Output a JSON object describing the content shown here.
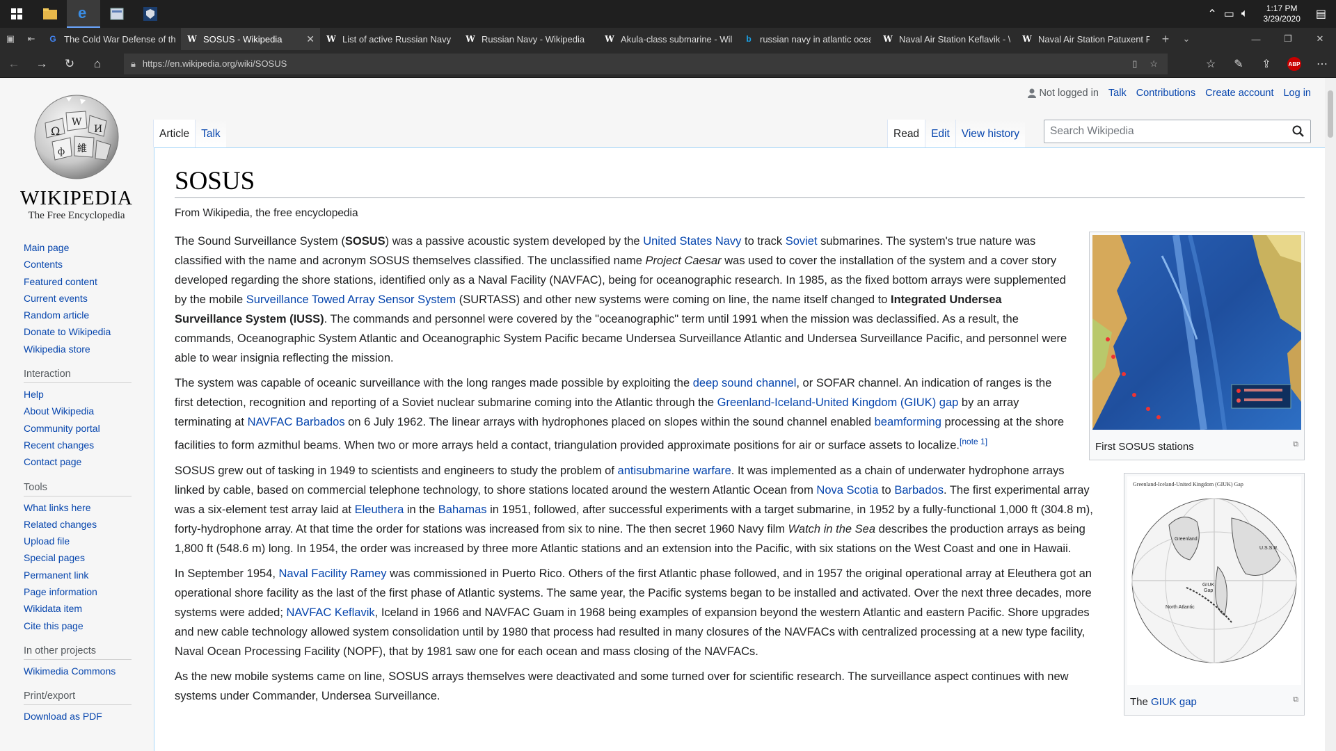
{
  "taskbar": {
    "time": "1:17 PM",
    "date": "3/29/2020"
  },
  "tabs": [
    {
      "label": "The Cold War Defense of th",
      "favicon": "google-icon",
      "active": false
    },
    {
      "label": "SOSUS - Wikipedia",
      "favicon": "wikipedia-icon",
      "active": true
    },
    {
      "label": "List of active Russian Navy s",
      "favicon": "wikipedia-icon",
      "active": false
    },
    {
      "label": "Russian Navy - Wikipedia",
      "favicon": "wikipedia-icon",
      "active": false
    },
    {
      "label": "Akula-class submarine - Wil",
      "favicon": "wikipedia-icon",
      "active": false
    },
    {
      "label": "russian navy in atlantic ocea",
      "favicon": "bing-icon",
      "active": false
    },
    {
      "label": "Naval Air Station Keflavik - \\",
      "favicon": "wikipedia-icon",
      "active": false
    },
    {
      "label": "Naval Air Station Patuxent F",
      "favicon": "wikipedia-icon",
      "active": false
    }
  ],
  "address": {
    "url": "https://en.wikipedia.org/wiki/SOSUS"
  },
  "logo": {
    "wordmark": "WIKIPEDIA",
    "tagline": "The Free Encyclopedia"
  },
  "sidebar": {
    "main": [
      "Main page",
      "Contents",
      "Featured content",
      "Current events",
      "Random article",
      "Donate to Wikipedia",
      "Wikipedia store"
    ],
    "interaction_head": "Interaction",
    "interaction": [
      "Help",
      "About Wikipedia",
      "Community portal",
      "Recent changes",
      "Contact page"
    ],
    "tools_head": "Tools",
    "tools": [
      "What links here",
      "Related changes",
      "Upload file",
      "Special pages",
      "Permanent link",
      "Page information",
      "Wikidata item",
      "Cite this page"
    ],
    "projects_head": "In other projects",
    "projects": [
      "Wikimedia Commons"
    ],
    "print_head": "Print/export",
    "print": [
      "Download as PDF"
    ]
  },
  "personal": {
    "not_logged": "Not logged in",
    "talk": "Talk",
    "contributions": "Contributions",
    "create": "Create account",
    "login": "Log in"
  },
  "page_tabs": {
    "article": "Article",
    "talk": "Talk",
    "read": "Read",
    "edit": "Edit",
    "history": "View history"
  },
  "search": {
    "placeholder": "Search Wikipedia"
  },
  "article": {
    "title": "SOSUS",
    "sub": "From Wikipedia, the free encyclopedia",
    "fig1_caption": "First SOSUS stations",
    "fig2_caption_pre": "The ",
    "fig2_caption_link": "GIUK gap",
    "p1": {
      "t1": "The Sound Surveillance System (",
      "b1": "SOSUS",
      "t2": ") was a passive acoustic system developed by the ",
      "l1": "United States Navy",
      "t3": " to track ",
      "l2": "Soviet",
      "t4": " submarines. The system's true nature was classified with the name and acronym SOSUS themselves classified. The unclassified name ",
      "i1": "Project Caesar",
      "t5": " was used to cover the installation of the system and a cover story developed regarding the shore stations, identified only as a Naval Facility (NAVFAC), being for oceanographic research. In 1985, as the fixed bottom arrays were supplemented by the mobile ",
      "l3": "Surveillance Towed Array Sensor System",
      "t6": " (SURTASS) and other new systems were coming on line, the name itself changed to ",
      "b2": "Integrated Undersea Surveillance System (IUSS)",
      "t7": ". The commands and personnel were covered by the \"oceanographic\" term until 1991 when the mission was declassified. As a result, the commands, Oceanographic System Atlantic and Oceanographic System Pacific became Undersea Surveillance Atlantic and Undersea Surveillance Pacific, and personnel were able to wear insignia reflecting the mission."
    },
    "p2": {
      "t1": "The system was capable of oceanic surveillance with the long ranges made possible by exploiting the ",
      "l1": "deep sound channel",
      "t2": ", or SOFAR channel. An indication of ranges is the first detection, recognition and reporting of a Soviet nuclear submarine coming into the Atlantic through the ",
      "l2": "Greenland-Iceland-United Kingdom (GIUK) gap",
      "t3": " by an array terminating at ",
      "l3": "NAVFAC Barbados",
      "t4": " on 6 July 1962. The linear arrays with hydrophones placed on slopes within the sound channel enabled ",
      "l4": "beamforming",
      "t5": " processing at the shore facilities to form azmithul beams. When two or more arrays held a contact, triangulation provided approximate positions for air or surface assets to localize.",
      "note": "[note 1]"
    },
    "p3": {
      "t1": "SOSUS grew out of tasking in 1949 to scientists and engineers to study the problem of ",
      "l1": "antisubmarine warfare",
      "t2": ". It was implemented as a chain of underwater hydrophone arrays linked by cable, based on commercial telephone technology, to shore stations located around the western Atlantic Ocean from ",
      "l2": "Nova Scotia",
      "t3": " to ",
      "l3": "Barbados",
      "t4": ". The first experimental array was a six-element test array laid at ",
      "l4": "Eleuthera",
      "t5": " in the ",
      "l5": "Bahamas",
      "t6": " in 1951, followed, after successful experiments with a target submarine, in 1952 by a fully-functional 1,000 ft (304.8 m), forty-hydrophone array. At that time the order for stations was increased from six to nine. The then secret 1960 Navy film ",
      "i1": "Watch in the Sea",
      "t7": " describes the production arrays as being 1,800 ft (548.6 m) long. In 1954, the order was increased by three more Atlantic stations and an extension into the Pacific, with six stations on the West Coast and one in Hawaii."
    },
    "p4": {
      "t1": "In September 1954, ",
      "l1": "Naval Facility Ramey",
      "t2": " was commissioned in Puerto Rico. Others of the first Atlantic phase followed, and in 1957 the original operational array at Eleuthera got an operational shore facility as the last of the first phase of Atlantic systems. The same year, the Pacific systems began to be installed and activated. Over the next three decades, more systems were added; ",
      "l2": "NAVFAC Keflavik",
      "t3": ", Iceland in 1966 and NAVFAC Guam in 1968 being examples of expansion beyond the western Atlantic and eastern Pacific. Shore upgrades and new cable technology allowed system consolidation until by 1980 that process had resulted in many closures of the NAVFACs with centralized processing at a new type facility, Naval Ocean Processing Facility (NOPF), that by 1981 saw one for each ocean and mass closing of the NAVFACs."
    },
    "p5": {
      "t1": "As the new mobile systems came on line, SOSUS arrays themselves were deactivated and some turned over for scientific research. The surveillance aspect continues with new systems under Commander, Undersea Surveillance."
    }
  }
}
